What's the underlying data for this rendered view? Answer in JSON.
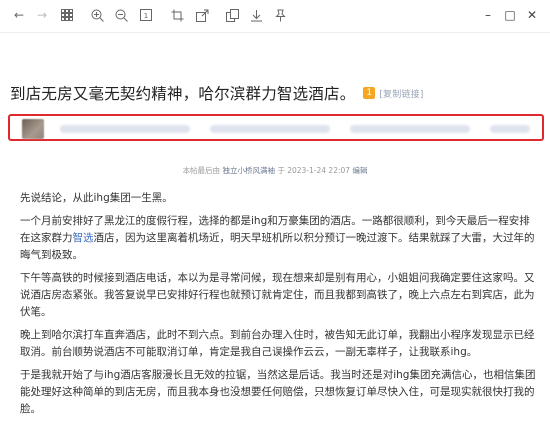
{
  "toolbar": {
    "icons": [
      "back-icon",
      "forward-icon",
      "grid-icon",
      "zoom-in-icon",
      "zoom-out-icon",
      "fit-page-icon",
      "crop-icon",
      "export-icon",
      "copy-icon",
      "download-icon",
      "pin-icon"
    ],
    "window": {
      "minimize": "–",
      "maximize": "□",
      "close": "✕"
    }
  },
  "article": {
    "title": "到店无房又毫无契约精神，哈尔滨群力智选酒店。",
    "badge": "1",
    "copy_link": "[复制链接]",
    "meta": {
      "prefix": "本帖最后由 ",
      "author": "独立小桥风满袖",
      "suffix": " 于 2023-1-24 22:07 ",
      "edit": "编辑"
    },
    "paragraphs": [
      {
        "text": "先说结论，从此ihg集团一生黑。"
      },
      {
        "text": "一个月前安排好了黑龙江的度假行程，选择的都是ihg和万豪集团的酒店。一路都很顺利，到今天最后一程安排在这家群力智选酒店，因为这里离着机场近，明天早班机所以积分预订一晚过渡下。结果就踩了大雷，大过年的晦气到极致。",
        "highlight": "智选"
      },
      {
        "text": "下午等高铁的时候接到酒店电话，本以为是寻常问候，现在想来却是别有用心，小姐姐问我确定要住这家吗。又说酒店房态紧张。我答复说早已安排好行程也就预订就肯定住，而且我都到高铁了，晚上六点左右到宾店，此为伏笔。"
      },
      {
        "text": "晚上到哈尔滨打车直奔酒店，此时不到六点。到前台办理入住时，被告知无此订单，我翻出小程序发现显示已经取消。前台顺势说酒店不可能取消订单，肯定是我自己误操作云云，一副无辜样子，让我联系ihg。"
      },
      {
        "text": "于是我就开始了与ihg酒店客服漫长且无效的拉锯，当然这是后话。我当时还是对ihg集团充满信心，也相信集团能处理好这种简单的到店无房，而且我本身也没想要任何赔偿，只想恢复订单尽快入住，可是现实就很快打我的脸。"
      }
    ]
  },
  "colors": {
    "highlight_border": "#e0292f",
    "link": "#3e6fc4",
    "badge": "#f5a623"
  }
}
